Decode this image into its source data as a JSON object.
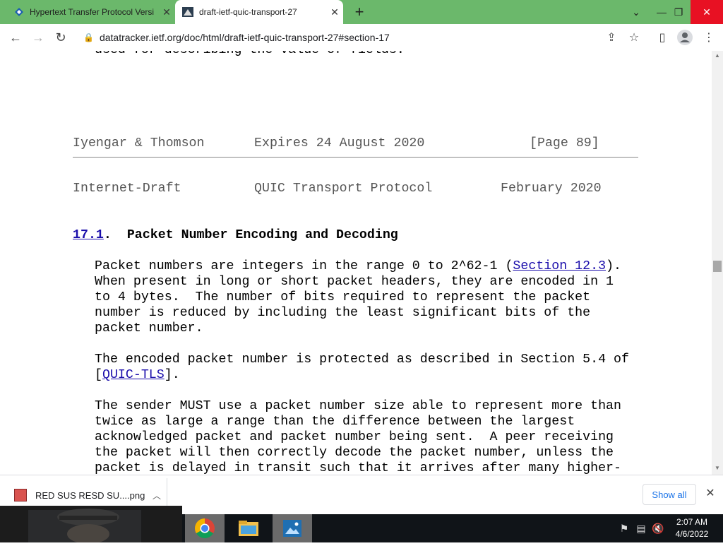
{
  "tabs": [
    {
      "title": "Hypertext Transfer Protocol Versi",
      "active": false
    },
    {
      "title": "draft-ietf-quic-transport-27",
      "active": true
    }
  ],
  "toolbar": {
    "url": "datatracker.ietf.org/doc/html/draft-ietf-quic-transport-27#section-17"
  },
  "document": {
    "top_fragment": "used for describing the value of fields.",
    "footer_left": "Iyengar & Thomson",
    "footer_mid": "Expires 24 August 2020",
    "footer_right": "[Page 89]",
    "header_left": "Internet-Draft",
    "header_mid": "QUIC Transport Protocol",
    "header_right": "February 2020",
    "section_number": "17.1",
    "section_sep": ".  ",
    "section_title": "Packet Number Encoding and Decoding",
    "p1_l1_a": "Packet numbers are integers in the range 0 to 2^62-1 (",
    "p1_l1_link": "Section 12.3",
    "p1_l1_b": ").",
    "p1_l2": "When present in long or short packet headers, they are encoded in 1",
    "p1_l3": "to 4 bytes.  The number of bits required to represent the packet",
    "p1_l4": "number is reduced by including the least significant bits of the",
    "p1_l5": "packet number.",
    "p2_l1": "The encoded packet number is protected as described in Section 5.4 of",
    "p2_l2_a": "[",
    "p2_l2_link": "QUIC-TLS",
    "p2_l2_b": "].",
    "p3_l1": "The sender MUST use a packet number size able to represent more than",
    "p3_l2": "twice as large a range than the difference between the largest",
    "p3_l3": "acknowledged packet and packet number being sent.  A peer receiving",
    "p3_l4": "the packet will then correctly decode the packet number, unless the",
    "p3_l5": "packet is delayed in transit such that it arrives after many higher-"
  },
  "downloads": {
    "file_name": "RED SUS RESD SU....png",
    "show_all": "Show all"
  },
  "taskbar": {
    "time": "2:07 AM",
    "date": "4/6/2022"
  },
  "colors": {
    "tab_strip": "#6bb86b",
    "link": "#1a0dab",
    "close_button": "#e81123"
  }
}
